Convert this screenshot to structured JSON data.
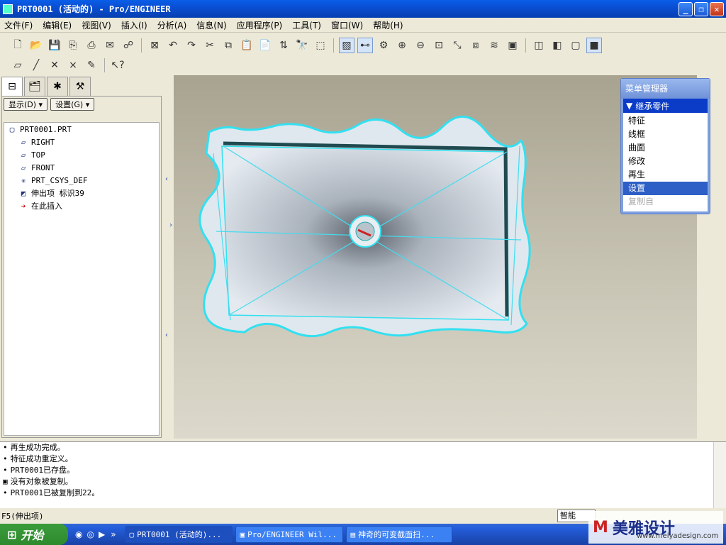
{
  "window": {
    "title": "PRT0001 (活动的) - Pro/ENGINEER"
  },
  "menubar": {
    "items": [
      "文件(F)",
      "编辑(E)",
      "视图(V)",
      "插入(I)",
      "分析(A)",
      "信息(N)",
      "应用程序(P)",
      "工具(T)",
      "窗口(W)",
      "帮助(H)"
    ]
  },
  "leftpanel": {
    "show_label": "显示(D)",
    "settings_label": "设置(G)",
    "tree": [
      {
        "icon": "part-icon",
        "label": "PRT0001.PRT"
      },
      {
        "icon": "datum-plane-icon",
        "label": "RIGHT"
      },
      {
        "icon": "datum-plane-icon",
        "label": "TOP"
      },
      {
        "icon": "datum-plane-icon",
        "label": "FRONT"
      },
      {
        "icon": "csys-icon",
        "label": "PRT_CSYS_DEF"
      },
      {
        "icon": "extrude-icon",
        "label": "伸出项 标识39"
      },
      {
        "icon": "insert-here-icon",
        "label": "在此插入"
      }
    ]
  },
  "menu_manager": {
    "title": "菜单管理器",
    "header": "继承零件",
    "items": [
      {
        "label": "特征",
        "state": "normal"
      },
      {
        "label": "线框",
        "state": "normal"
      },
      {
        "label": "曲面",
        "state": "normal"
      },
      {
        "label": "修改",
        "state": "normal"
      },
      {
        "label": "再生",
        "state": "normal"
      },
      {
        "label": "设置",
        "state": "selected"
      },
      {
        "label": "复制自",
        "state": "disabled"
      }
    ]
  },
  "messages": [
    {
      "bullet": "•",
      "text": "再生成功完成。"
    },
    {
      "bullet": "•",
      "text": "特征成功重定义。"
    },
    {
      "bullet": "•",
      "text": "PRT0001已存盘。"
    },
    {
      "bullet": "▣",
      "text": "没有对象被复制。"
    },
    {
      "bullet": "•",
      "text": "PRT0001已被复制到22。"
    }
  ],
  "statusbar": {
    "text": "F5(伸出项)",
    "smart": "智能"
  },
  "taskbar": {
    "start": "开始",
    "buttons": [
      "PRT0001 (活动的)...",
      "Pro/ENGINEER Wil...",
      "神奇的可变截面扫..."
    ]
  },
  "watermark": {
    "brand": "美雅设计",
    "url": "www.meiyadesign.com"
  },
  "colors": {
    "accent": "#0b3cc8",
    "model_edge": "#33e0f0",
    "selected": "#2d5fc6"
  }
}
